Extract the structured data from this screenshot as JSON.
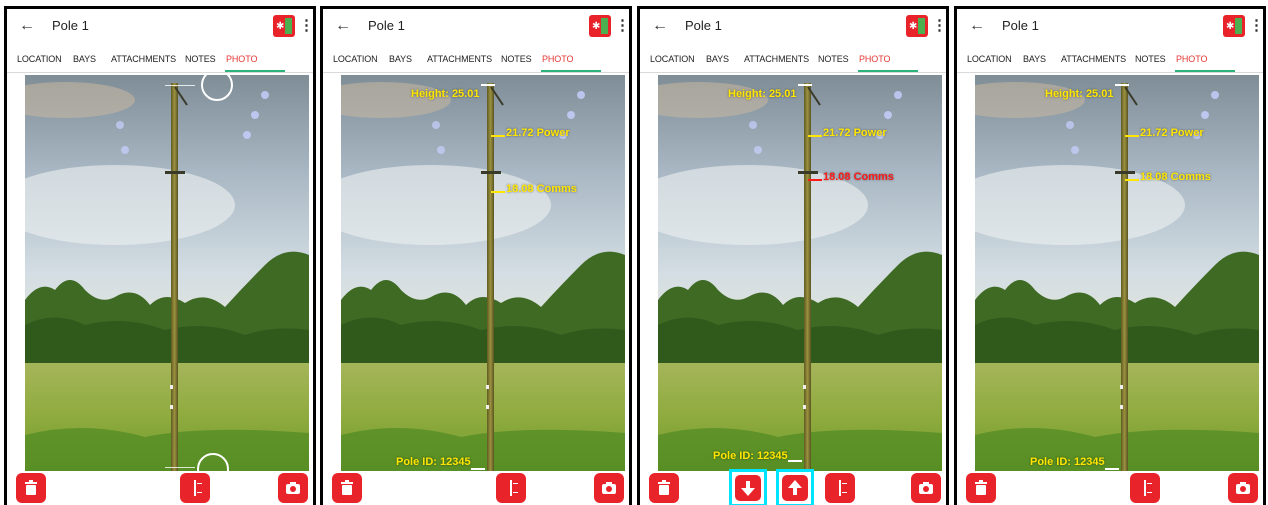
{
  "colors": {
    "accent_red": "#e8232a",
    "active_tab": "#e53935",
    "tab_indicator": "#2bb37b",
    "label_yellow": "#ffe600",
    "label_red": "#ff1a1a",
    "highlight_cyan": "#00e5ff"
  },
  "panels": [
    {
      "title": "Pole 1",
      "tabs": [
        "LOCATION",
        "BAYS",
        "ATTACHMENTS",
        "NOTES",
        "PHOTO"
      ],
      "active_tab": "PHOTO",
      "labels": {}
    },
    {
      "title": "Pole 1",
      "tabs": [
        "LOCATION",
        "BAYS",
        "ATTACHMENTS",
        "NOTES",
        "PHOTO"
      ],
      "active_tab": "PHOTO",
      "labels": {
        "height": "Height: 25.01",
        "power": "21.72 Power",
        "comms": "18.08 Comms",
        "pole_id": "Pole ID: 12345"
      }
    },
    {
      "title": "Pole 1",
      "tabs": [
        "LOCATION",
        "BAYS",
        "ATTACHMENTS",
        "NOTES",
        "PHOTO"
      ],
      "active_tab": "PHOTO",
      "labels": {
        "height": "Height: 25.01",
        "power": "21.72 Power",
        "comms": "18.08 Comms",
        "pole_id": "Pole ID: 12345"
      }
    },
    {
      "title": "Pole 1",
      "tabs": [
        "LOCATION",
        "BAYS",
        "ATTACHMENTS",
        "NOTES",
        "PHOTO"
      ],
      "active_tab": "PHOTO",
      "labels": {
        "height": "Height: 25.01",
        "power": "21.72 Power",
        "comms": "18.08 Comms",
        "pole_id": "Pole ID: 12345"
      }
    }
  ],
  "icons": {
    "back": "arrow-left-icon",
    "more": "more-vert-icon",
    "app": "pole-app-icon",
    "trash": "trash-icon",
    "camera": "camera-icon",
    "measure": "pole-measure-icon",
    "down": "arrow-down-icon",
    "up": "arrow-up-icon"
  }
}
